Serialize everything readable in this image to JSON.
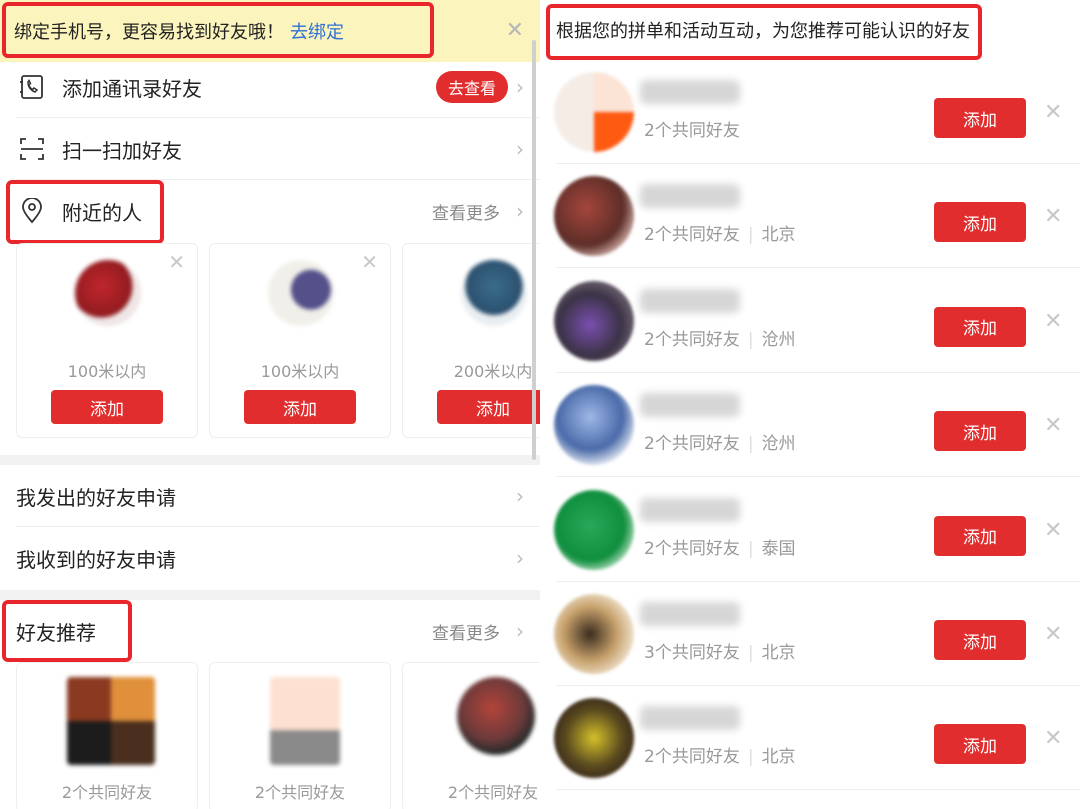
{
  "bind_banner": {
    "text": "绑定手机号，更容易找到好友哦！",
    "link": "去绑定"
  },
  "menu": {
    "contacts": {
      "label": "添加通讯录好友",
      "pill": "去查看"
    },
    "scan": {
      "label": "扫一扫加好友"
    },
    "nearby": {
      "label": "附近的人",
      "see_more": "查看更多"
    }
  },
  "nearby_cards": [
    {
      "distance": "100米以内",
      "add": "添加"
    },
    {
      "distance": "100米以内",
      "add": "添加"
    },
    {
      "distance": "200米以内",
      "add": "添加"
    }
  ],
  "requests": {
    "sent": "我发出的好友申请",
    "received": "我收到的好友申请"
  },
  "recommend": {
    "title": "好友推荐",
    "see_more": "查看更多",
    "cards": [
      {
        "mutual": "2个共同好友"
      },
      {
        "mutual": "2个共同好友"
      },
      {
        "mutual": "2个共同好友"
      }
    ]
  },
  "right": {
    "hint": "根据您的拼单和活动互动，为您推荐可能认识的好友",
    "friends": [
      {
        "mutual": "2个共同好友",
        "location": "",
        "add": "添加"
      },
      {
        "mutual": "2个共同好友",
        "location": "北京",
        "add": "添加"
      },
      {
        "mutual": "2个共同好友",
        "location": "沧州",
        "add": "添加"
      },
      {
        "mutual": "2个共同好友",
        "location": "沧州",
        "add": "添加"
      },
      {
        "mutual": "2个共同好友",
        "location": "泰国",
        "add": "添加"
      },
      {
        "mutual": "3个共同好友",
        "location": "北京",
        "add": "添加"
      },
      {
        "mutual": "2个共同好友",
        "location": "北京",
        "add": "添加"
      }
    ]
  },
  "colors": {
    "accent": "#e12d2d",
    "highlight_box": "#e8262b",
    "banner_bg": "#fbf4bc",
    "link": "#2f6fd6"
  }
}
